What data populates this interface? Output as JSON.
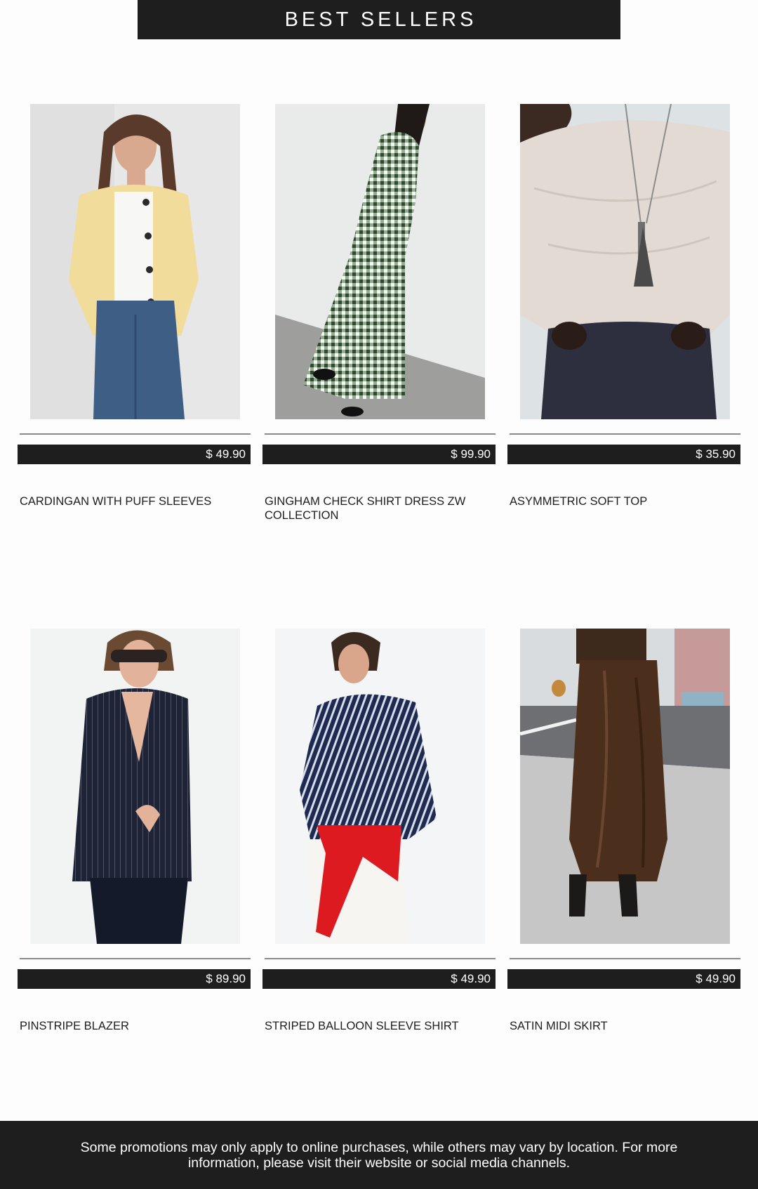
{
  "header": {
    "title": "BEST SELLERS"
  },
  "products": [
    {
      "name": "CARDINGAN WITH PUFF SLEEVES",
      "price": "$ 49.90",
      "image": "cardigan-photo"
    },
    {
      "name": "GINGHAM CHECK SHIRT DRESS ZW COLLECTION",
      "price": "$ 99.90",
      "image": "gingham-dress-photo"
    },
    {
      "name": "ASYMMETRIC SOFT TOP",
      "price": "$ 35.90",
      "image": "soft-top-photo"
    },
    {
      "name": "PINSTRIPE BLAZER",
      "price": "$ 89.90",
      "image": "blazer-photo"
    },
    {
      "name": "STRIPED BALLOON SLEEVE SHIRT",
      "price": "$ 49.90",
      "image": "striped-shirt-photo"
    },
    {
      "name": "SATIN MIDI SKIRT",
      "price": "$ 49.90",
      "image": "satin-skirt-photo"
    }
  ],
  "footer": {
    "text": "Some promotions may only apply to online purchases, while others may vary by location. For more information, please visit their website or social media channels."
  },
  "colors": {
    "bar": "#1e1e1e",
    "background": "#fdfdfd",
    "divider": "#8a8a8a"
  }
}
